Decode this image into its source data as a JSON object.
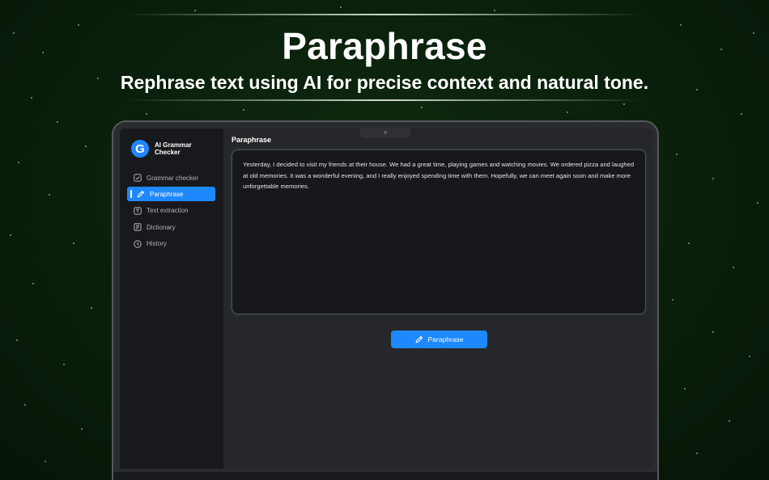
{
  "hero": {
    "title": "Paraphrase",
    "subtitle": "Rephrase text using AI for precise context and natural tone."
  },
  "app": {
    "name": "AI Grammar Checker",
    "logo_letter": "G",
    "accent_color": "#1e88ff"
  },
  "sidebar": {
    "items": [
      {
        "label": "Grammar checker",
        "icon": "check-square-icon",
        "active": false
      },
      {
        "label": "Paraphrase",
        "icon": "pencil-icon",
        "active": true
      },
      {
        "label": "Text extraction",
        "icon": "text-box-icon",
        "active": false
      },
      {
        "label": "Dictionary",
        "icon": "book-icon",
        "active": false
      },
      {
        "label": "History",
        "icon": "clock-icon",
        "active": false
      }
    ]
  },
  "main": {
    "title": "Paraphrase",
    "input_text": "Yesterday, I decided to visit my friends at their house. We had a great time, playing games and watching movies. We ordered pizza and laughed at old memories. It was a wonderful evening, and I really enjoyed spending time with them. Hopefully, we can meet again soon and make more unforgettable memories.",
    "button_label": "Paraphrase"
  }
}
